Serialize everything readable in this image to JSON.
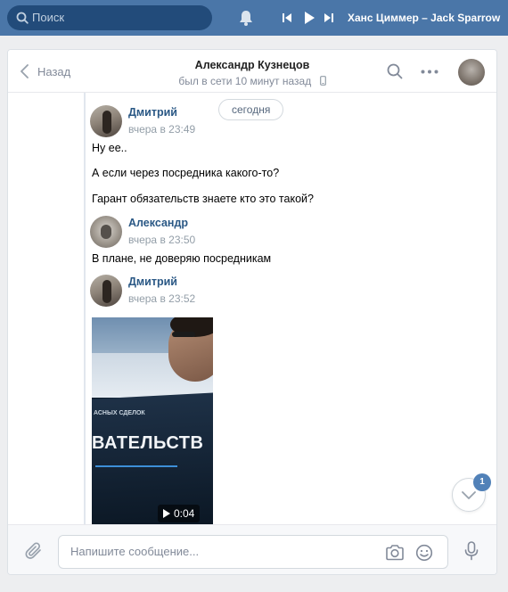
{
  "topbar": {
    "search_placeholder": "Поиск",
    "track": "Ханс Циммер – Jack Sparrow"
  },
  "header": {
    "back_label": "Назад",
    "name": "Александр Кузнецов",
    "status": "был в сети 10 минут назад"
  },
  "chat": {
    "date_separator": "сегодня",
    "messages": [
      {
        "author": "Дмитрий",
        "time": "вчера в 23:49",
        "lines": [
          "Ну ее..",
          "А если через посредника какого-то?",
          "Гарант обязательств знаете кто это такой?"
        ]
      },
      {
        "author": "Александр",
        "time": "вчера в 23:50",
        "lines": [
          "В плане, не доверяю посредникам"
        ]
      },
      {
        "author": "Дмитрий",
        "time": "вчера в 23:52",
        "video": {
          "small_text": "АСНЫХ СДЕЛОК",
          "big_text": "ВАТЕЛЬСТВ",
          "duration": "0:04"
        }
      }
    ],
    "unread_count": "1"
  },
  "composer": {
    "placeholder": "Напишите сообщение..."
  },
  "colors": {
    "topbar": "#4a76a8",
    "link": "#2a5885",
    "badge": "#5181b8"
  }
}
